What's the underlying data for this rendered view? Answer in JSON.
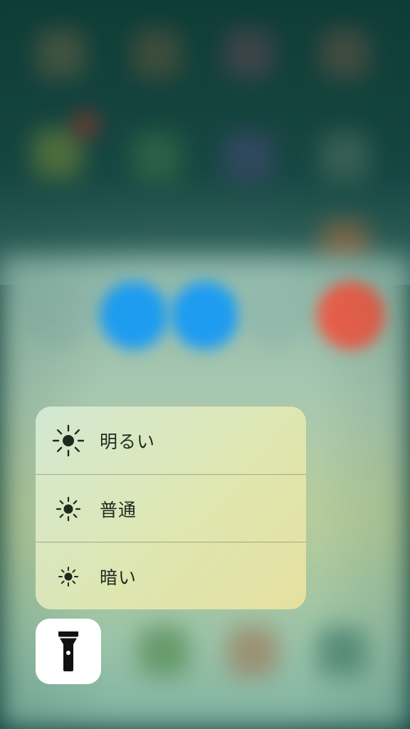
{
  "flashlight_menu": {
    "items": [
      {
        "label": "明るい",
        "icon": "sun-large-icon"
      },
      {
        "label": "普通",
        "icon": "sun-medium-icon"
      },
      {
        "label": "暗い",
        "icon": "sun-small-icon"
      }
    ]
  },
  "flashlight_button": {
    "icon": "flashlight-icon"
  },
  "colors": {
    "menu_tint": "#e2e8b2",
    "icon_dark": "#1d2a1e",
    "control_blue": "#1e9cf0",
    "control_red": "#f0604a",
    "background_teal": "#123f3a"
  }
}
